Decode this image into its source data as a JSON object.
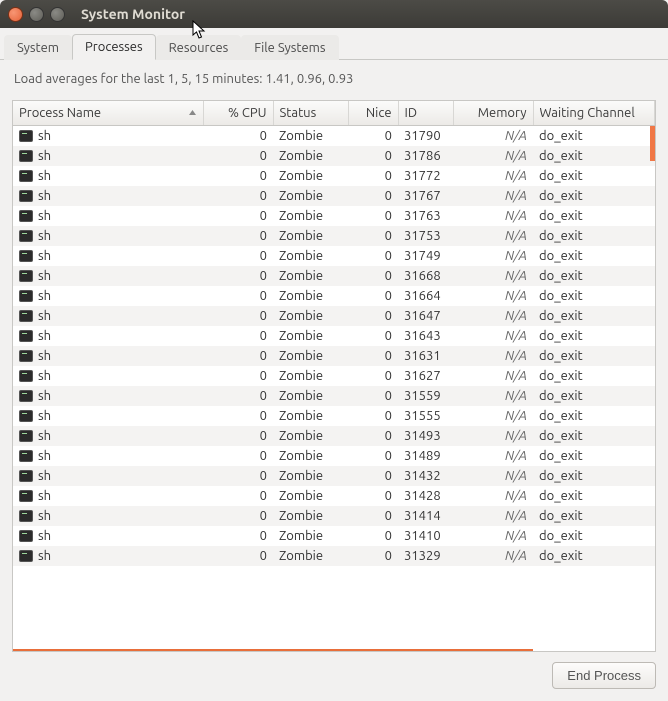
{
  "window": {
    "title": "System Monitor"
  },
  "tabs": [
    {
      "label": "System"
    },
    {
      "label": "Processes"
    },
    {
      "label": "Resources"
    },
    {
      "label": "File Systems"
    }
  ],
  "loadavg_text": "Load averages for the last 1, 5, 15 minutes: 1.41, 0.96, 0.93",
  "columns": {
    "pname": "Process Name",
    "cpu": "% CPU",
    "status": "Status",
    "nice": "Nice",
    "id": "ID",
    "memory": "Memory",
    "wait": "Waiting Channel"
  },
  "processes": [
    {
      "name": "sh",
      "cpu": 0,
      "status": "Zombie",
      "nice": 0,
      "id": 31790,
      "memory": "N/A",
      "wait": "do_exit"
    },
    {
      "name": "sh",
      "cpu": 0,
      "status": "Zombie",
      "nice": 0,
      "id": 31786,
      "memory": "N/A",
      "wait": "do_exit"
    },
    {
      "name": "sh",
      "cpu": 0,
      "status": "Zombie",
      "nice": 0,
      "id": 31772,
      "memory": "N/A",
      "wait": "do_exit"
    },
    {
      "name": "sh",
      "cpu": 0,
      "status": "Zombie",
      "nice": 0,
      "id": 31767,
      "memory": "N/A",
      "wait": "do_exit"
    },
    {
      "name": "sh",
      "cpu": 0,
      "status": "Zombie",
      "nice": 0,
      "id": 31763,
      "memory": "N/A",
      "wait": "do_exit"
    },
    {
      "name": "sh",
      "cpu": 0,
      "status": "Zombie",
      "nice": 0,
      "id": 31753,
      "memory": "N/A",
      "wait": "do_exit"
    },
    {
      "name": "sh",
      "cpu": 0,
      "status": "Zombie",
      "nice": 0,
      "id": 31749,
      "memory": "N/A",
      "wait": "do_exit"
    },
    {
      "name": "sh",
      "cpu": 0,
      "status": "Zombie",
      "nice": 0,
      "id": 31668,
      "memory": "N/A",
      "wait": "do_exit"
    },
    {
      "name": "sh",
      "cpu": 0,
      "status": "Zombie",
      "nice": 0,
      "id": 31664,
      "memory": "N/A",
      "wait": "do_exit"
    },
    {
      "name": "sh",
      "cpu": 0,
      "status": "Zombie",
      "nice": 0,
      "id": 31647,
      "memory": "N/A",
      "wait": "do_exit"
    },
    {
      "name": "sh",
      "cpu": 0,
      "status": "Zombie",
      "nice": 0,
      "id": 31643,
      "memory": "N/A",
      "wait": "do_exit"
    },
    {
      "name": "sh",
      "cpu": 0,
      "status": "Zombie",
      "nice": 0,
      "id": 31631,
      "memory": "N/A",
      "wait": "do_exit"
    },
    {
      "name": "sh",
      "cpu": 0,
      "status": "Zombie",
      "nice": 0,
      "id": 31627,
      "memory": "N/A",
      "wait": "do_exit"
    },
    {
      "name": "sh",
      "cpu": 0,
      "status": "Zombie",
      "nice": 0,
      "id": 31559,
      "memory": "N/A",
      "wait": "do_exit"
    },
    {
      "name": "sh",
      "cpu": 0,
      "status": "Zombie",
      "nice": 0,
      "id": 31555,
      "memory": "N/A",
      "wait": "do_exit"
    },
    {
      "name": "sh",
      "cpu": 0,
      "status": "Zombie",
      "nice": 0,
      "id": 31493,
      "memory": "N/A",
      "wait": "do_exit"
    },
    {
      "name": "sh",
      "cpu": 0,
      "status": "Zombie",
      "nice": 0,
      "id": 31489,
      "memory": "N/A",
      "wait": "do_exit"
    },
    {
      "name": "sh",
      "cpu": 0,
      "status": "Zombie",
      "nice": 0,
      "id": 31432,
      "memory": "N/A",
      "wait": "do_exit"
    },
    {
      "name": "sh",
      "cpu": 0,
      "status": "Zombie",
      "nice": 0,
      "id": 31428,
      "memory": "N/A",
      "wait": "do_exit"
    },
    {
      "name": "sh",
      "cpu": 0,
      "status": "Zombie",
      "nice": 0,
      "id": 31414,
      "memory": "N/A",
      "wait": "do_exit"
    },
    {
      "name": "sh",
      "cpu": 0,
      "status": "Zombie",
      "nice": 0,
      "id": 31410,
      "memory": "N/A",
      "wait": "do_exit"
    },
    {
      "name": "sh",
      "cpu": 0,
      "status": "Zombie",
      "nice": 0,
      "id": 31329,
      "memory": "N/A",
      "wait": "do_exit"
    }
  ],
  "footer": {
    "end_process": "End Process"
  }
}
